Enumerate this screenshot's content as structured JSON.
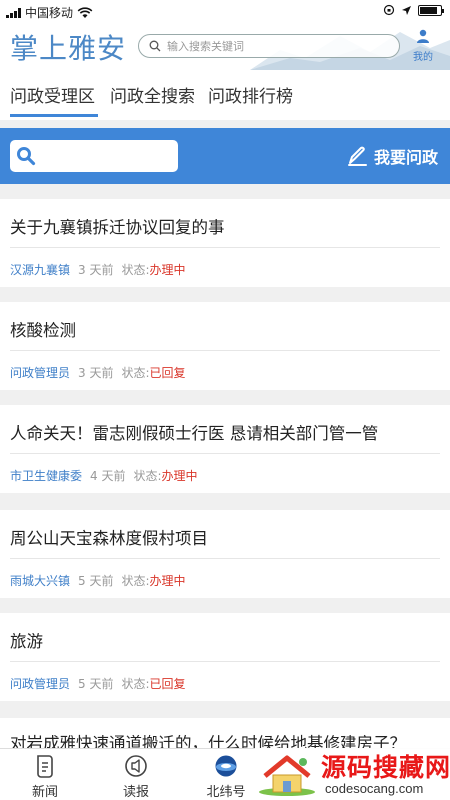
{
  "status_bar": {
    "carrier": "中国移动",
    "battery_level": 0.85
  },
  "header": {
    "logo": "掌上雅安",
    "search_placeholder": "输入搜索关键词",
    "me_label": "我的"
  },
  "tabs": [
    {
      "label": "问政受理区",
      "active": true
    },
    {
      "label": "问政全搜索",
      "active": false
    },
    {
      "label": "问政排行榜",
      "active": false
    }
  ],
  "action_bar": {
    "ask_label": "我要问政",
    "color": "#3f86d8"
  },
  "items": [
    {
      "title": "关于九襄镇拆迁协议回复的事",
      "source": "汉源九襄镇",
      "time": "3 天前",
      "status_label": "状态:",
      "status": "办理中"
    },
    {
      "title": "核酸检测",
      "source": "问政管理员",
      "time": "3 天前",
      "status_label": "状态:",
      "status": "已回复"
    },
    {
      "title": "人命关天！雷志刚假硕士行医 恳请相关部门管一管",
      "source": "市卫生健康委",
      "time": "4 天前",
      "status_label": "状态:",
      "status": "办理中"
    },
    {
      "title": "周公山天宝森林度假村项目",
      "source": "雨城大兴镇",
      "time": "5 天前",
      "status_label": "状态:",
      "status": "办理中"
    },
    {
      "title": "旅游",
      "source": "问政管理员",
      "time": "5 天前",
      "status_label": "状态:",
      "status": "已回复"
    }
  ],
  "partial_item": {
    "title": "对岩成雅快速通道搬迁的，什么时候给地基修建房子？"
  },
  "bottom_nav": [
    {
      "label": "新闻",
      "icon": "news-icon"
    },
    {
      "label": "读报",
      "icon": "newspaper-icon"
    },
    {
      "label": "北纬号",
      "icon": "beiwei-icon"
    }
  ],
  "watermark": {
    "main": "源码搜藏网",
    "sub": "codesocang.com"
  },
  "colors": {
    "accent": "#3f86d8",
    "status_red": "#d9362a",
    "source_blue": "#3f7fc8"
  }
}
